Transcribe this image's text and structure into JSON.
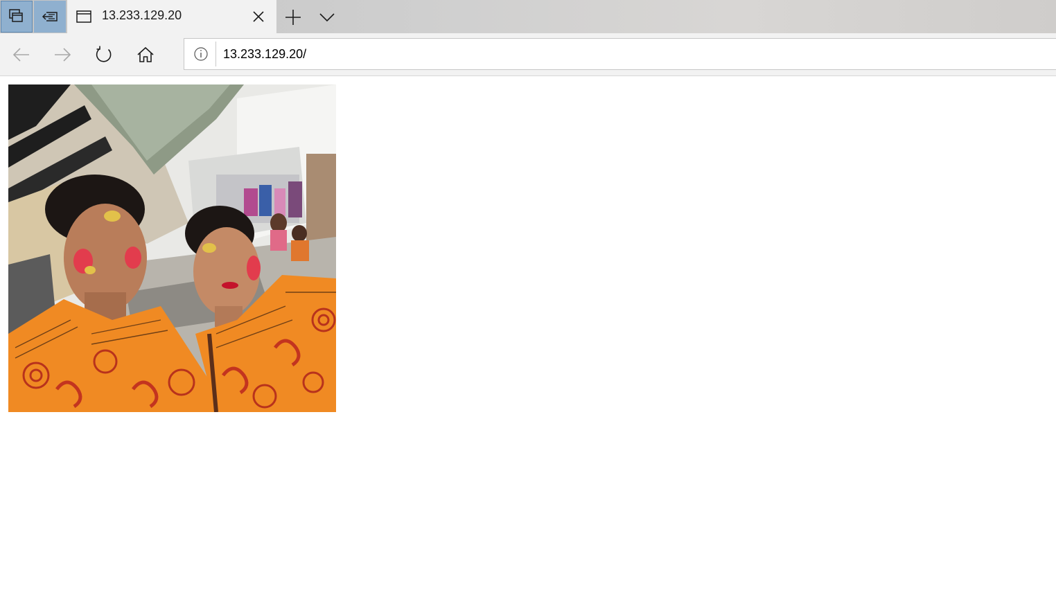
{
  "browser": {
    "tab": {
      "title": "13.233.129.20"
    },
    "address_bar": {
      "url": "13.233.129.20/"
    },
    "icons": {
      "set_aside_tabs": "tabs-aside-icon",
      "show_tabs_aside": "show-tabs-aside-icon",
      "tab_page": "page-icon",
      "close_tab": "close-icon",
      "new_tab": "plus-icon",
      "tab_preview": "chevron-down-icon",
      "back": "back-arrow-icon",
      "forward": "forward-arrow-icon",
      "refresh": "refresh-icon",
      "home": "home-icon",
      "site_info": "info-icon"
    }
  },
  "page": {
    "image": {
      "subject": "selfie photo"
    }
  }
}
